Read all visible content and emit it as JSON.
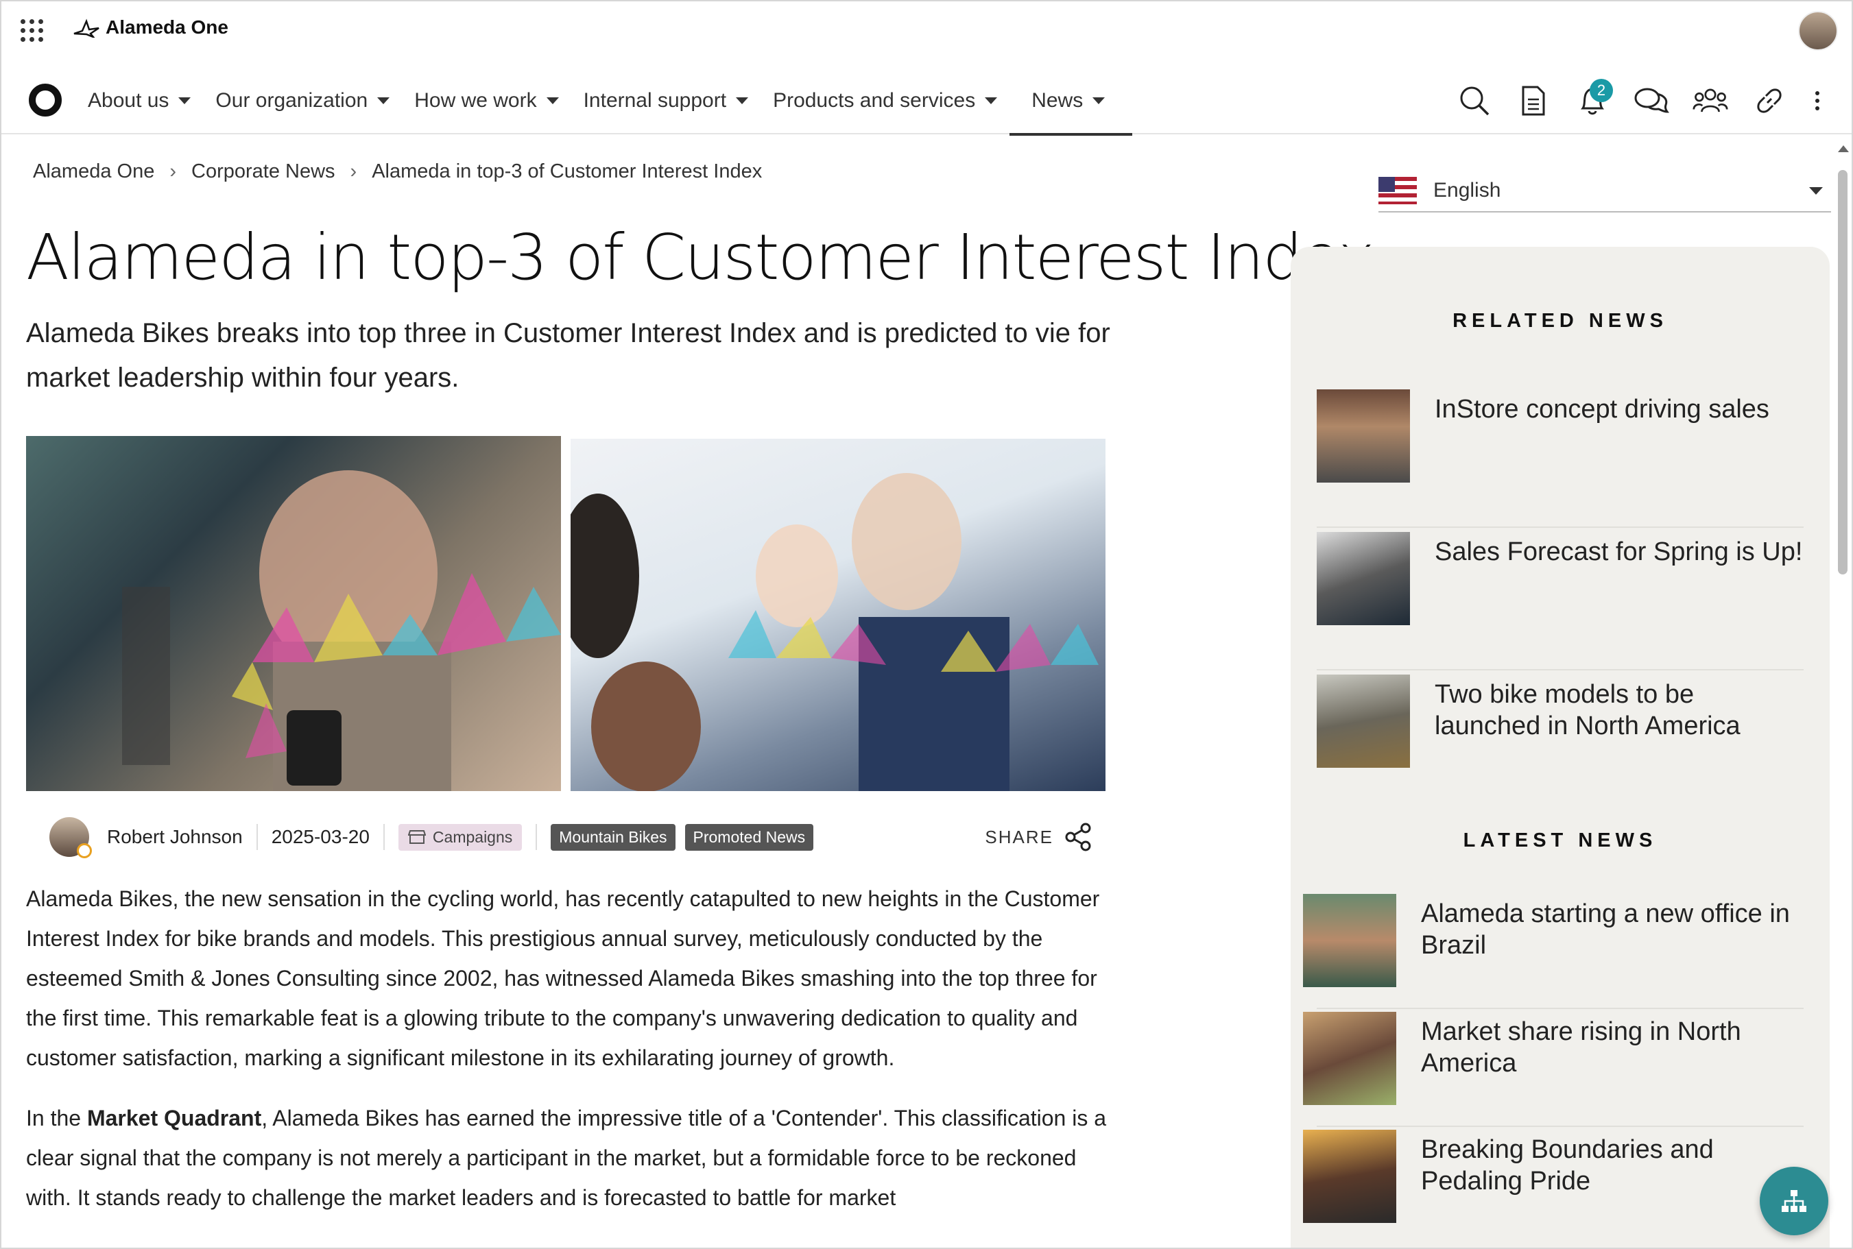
{
  "brand": {
    "name": "Alameda One"
  },
  "nav": {
    "items": [
      {
        "label": "About us"
      },
      {
        "label": "Our organization"
      },
      {
        "label": "How we work"
      },
      {
        "label": "Internal support"
      },
      {
        "label": "Products and services"
      },
      {
        "label": "News"
      }
    ],
    "active": "News",
    "notification_count": "2"
  },
  "breadcrumb": [
    "Alameda One",
    "Corporate News",
    "Alameda in top-3 of Customer Interest Index"
  ],
  "article": {
    "title": "Alameda in top-3 of Customer Interest Index",
    "lead": "Alameda Bikes breaks into top three in Customer Interest Index and is predicted to vie for market leadership within four years.",
    "author": "Robert Johnson",
    "date": "2025-03-20",
    "category": "Campaigns",
    "tags": [
      "Mountain Bikes",
      "Promoted News"
    ],
    "share_label": "SHARE",
    "para1": "Alameda Bikes, the new sensation in the cycling world, has recently catapulted to new heights in the Customer Interest Index for bike brands and models. This prestigious annual survey, meticulously conducted by the esteemed Smith & Jones Consulting since 2002, has witnessed Alameda Bikes smashing into the top three for the first time. This remarkable feat is a glowing tribute to the company's unwavering dedication to quality and customer satisfaction, marking a significant milestone in its exhilarating journey of growth.",
    "para2_pre": "In the ",
    "para2_bold": "Market Quadrant",
    "para2_post": ", Alameda Bikes has earned the impressive title of a 'Contender'. This classification is a clear signal that the company is not merely a participant in the market, but a formidable force to be reckoned with. It stands ready to challenge the market leaders and is forecasted to battle for market"
  },
  "language": {
    "selected": "English"
  },
  "related": {
    "title": "RELATED NEWS",
    "items": [
      {
        "title": "InStore concept driving sales"
      },
      {
        "title": "Sales Forecast for Spring is Up!"
      },
      {
        "title": "Two bike models to be launched in North America"
      }
    ]
  },
  "latest": {
    "title": "LATEST NEWS",
    "items": [
      {
        "title": "Alameda starting a new office in Brazil"
      },
      {
        "title": "Market share rising in North America"
      },
      {
        "title": "Breaking Boundaries and Pedaling Pride"
      }
    ]
  },
  "colors": {
    "accent": "#1a9aa6",
    "fab": "#2c8c92",
    "panel": "#f1f0ec"
  }
}
